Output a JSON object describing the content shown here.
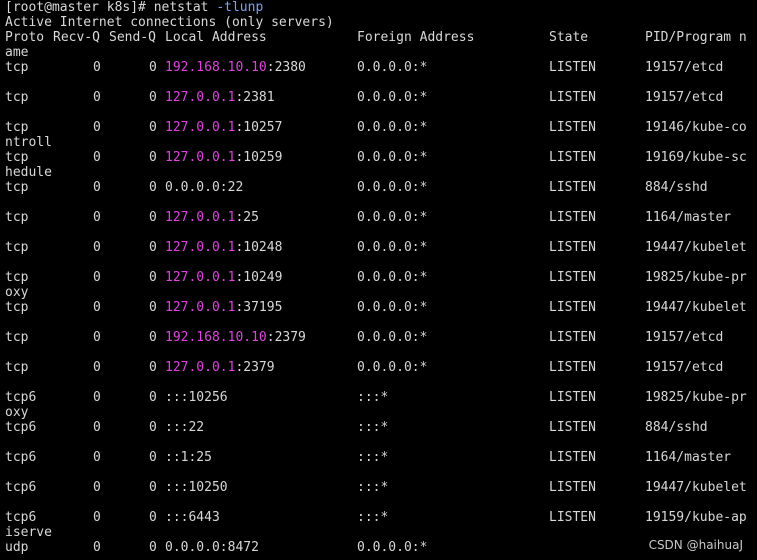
{
  "prompt": {
    "text": "[root@master k8s]# netstat ",
    "arg": "-tlunp"
  },
  "banner": "Active Internet connections (only servers)",
  "headers": {
    "proto": "Proto",
    "recv": "Recv-Q",
    "send": "Send-Q",
    "local": "Local Address",
    "foreign": "Foreign Address",
    "state": "State",
    "pid": "PID/Program n",
    "pid_wrap": "ame"
  },
  "rows": [
    {
      "proto": "tcp",
      "recv": "0",
      "send": "0",
      "ip": "192.168.10.10",
      "port": ":2380",
      "foreign": "0.0.0.0:*",
      "state": "LISTEN",
      "pid": "19157/etcd",
      "wrap": ""
    },
    {
      "proto": "tcp",
      "recv": "0",
      "send": "0",
      "ip": "127.0.0.1",
      "port": ":2381",
      "foreign": "0.0.0.0:*",
      "state": "LISTEN",
      "pid": "19157/etcd",
      "wrap": ""
    },
    {
      "proto": "tcp",
      "recv": "0",
      "send": "0",
      "ip": "127.0.0.1",
      "port": ":10257",
      "foreign": "0.0.0.0:*",
      "state": "LISTEN",
      "pid": "19146/kube-co",
      "wrap": "ntroll"
    },
    {
      "proto": "tcp",
      "recv": "0",
      "send": "0",
      "ip": "127.0.0.1",
      "port": ":10259",
      "foreign": "0.0.0.0:*",
      "state": "LISTEN",
      "pid": "19169/kube-sc",
      "wrap": "hedule"
    },
    {
      "proto": "tcp",
      "recv": "0",
      "send": "0",
      "ip": "",
      "port": "0.0.0.0:22",
      "foreign": "0.0.0.0:*",
      "state": "LISTEN",
      "pid": "884/sshd",
      "wrap": ""
    },
    {
      "proto": "tcp",
      "recv": "0",
      "send": "0",
      "ip": "127.0.0.1",
      "port": ":25",
      "foreign": "0.0.0.0:*",
      "state": "LISTEN",
      "pid": "1164/master",
      "wrap": ""
    },
    {
      "proto": "tcp",
      "recv": "0",
      "send": "0",
      "ip": "127.0.0.1",
      "port": ":10248",
      "foreign": "0.0.0.0:*",
      "state": "LISTEN",
      "pid": "19447/kubelet",
      "wrap": ""
    },
    {
      "proto": "tcp",
      "recv": "0",
      "send": "0",
      "ip": "127.0.0.1",
      "port": ":10249",
      "foreign": "0.0.0.0:*",
      "state": "LISTEN",
      "pid": "19825/kube-pr",
      "wrap": "oxy"
    },
    {
      "proto": "tcp",
      "recv": "0",
      "send": "0",
      "ip": "127.0.0.1",
      "port": ":37195",
      "foreign": "0.0.0.0:*",
      "state": "LISTEN",
      "pid": "19447/kubelet",
      "wrap": ""
    },
    {
      "proto": "tcp",
      "recv": "0",
      "send": "0",
      "ip": "192.168.10.10",
      "port": ":2379",
      "foreign": "0.0.0.0:*",
      "state": "LISTEN",
      "pid": "19157/etcd",
      "wrap": ""
    },
    {
      "proto": "tcp",
      "recv": "0",
      "send": "0",
      "ip": "127.0.0.1",
      "port": ":2379",
      "foreign": "0.0.0.0:*",
      "state": "LISTEN",
      "pid": "19157/etcd",
      "wrap": ""
    },
    {
      "proto": "tcp6",
      "recv": "0",
      "send": "0",
      "ip": "",
      "port": ":::10256",
      "foreign": ":::*",
      "state": "LISTEN",
      "pid": "19825/kube-pr",
      "wrap": "oxy"
    },
    {
      "proto": "tcp6",
      "recv": "0",
      "send": "0",
      "ip": "",
      "port": ":::22",
      "foreign": ":::*",
      "state": "LISTEN",
      "pid": "884/sshd",
      "wrap": ""
    },
    {
      "proto": "tcp6",
      "recv": "0",
      "send": "0",
      "ip": "",
      "port": "::1:25",
      "foreign": ":::*",
      "state": "LISTEN",
      "pid": "1164/master",
      "wrap": ""
    },
    {
      "proto": "tcp6",
      "recv": "0",
      "send": "0",
      "ip": "",
      "port": ":::10250",
      "foreign": ":::*",
      "state": "LISTEN",
      "pid": "19447/kubelet",
      "wrap": ""
    },
    {
      "proto": "tcp6",
      "recv": "0",
      "send": "0",
      "ip": "",
      "port": ":::6443",
      "foreign": ":::*",
      "state": "LISTEN",
      "pid": "19159/kube-ap",
      "wrap": "iserve"
    },
    {
      "proto": "udp",
      "recv": "0",
      "send": "0",
      "ip": "",
      "port": "0.0.0.0:8472",
      "foreign": "0.0.0.0:*",
      "state": "",
      "pid": "",
      "wrap": ""
    }
  ],
  "watermark": "CSDN @haihuaJ",
  "colors": {
    "background": "#000000",
    "text": "#d8d8d8",
    "ip_highlight": "#e040e0",
    "arg_highlight": "#7aa2f7"
  }
}
